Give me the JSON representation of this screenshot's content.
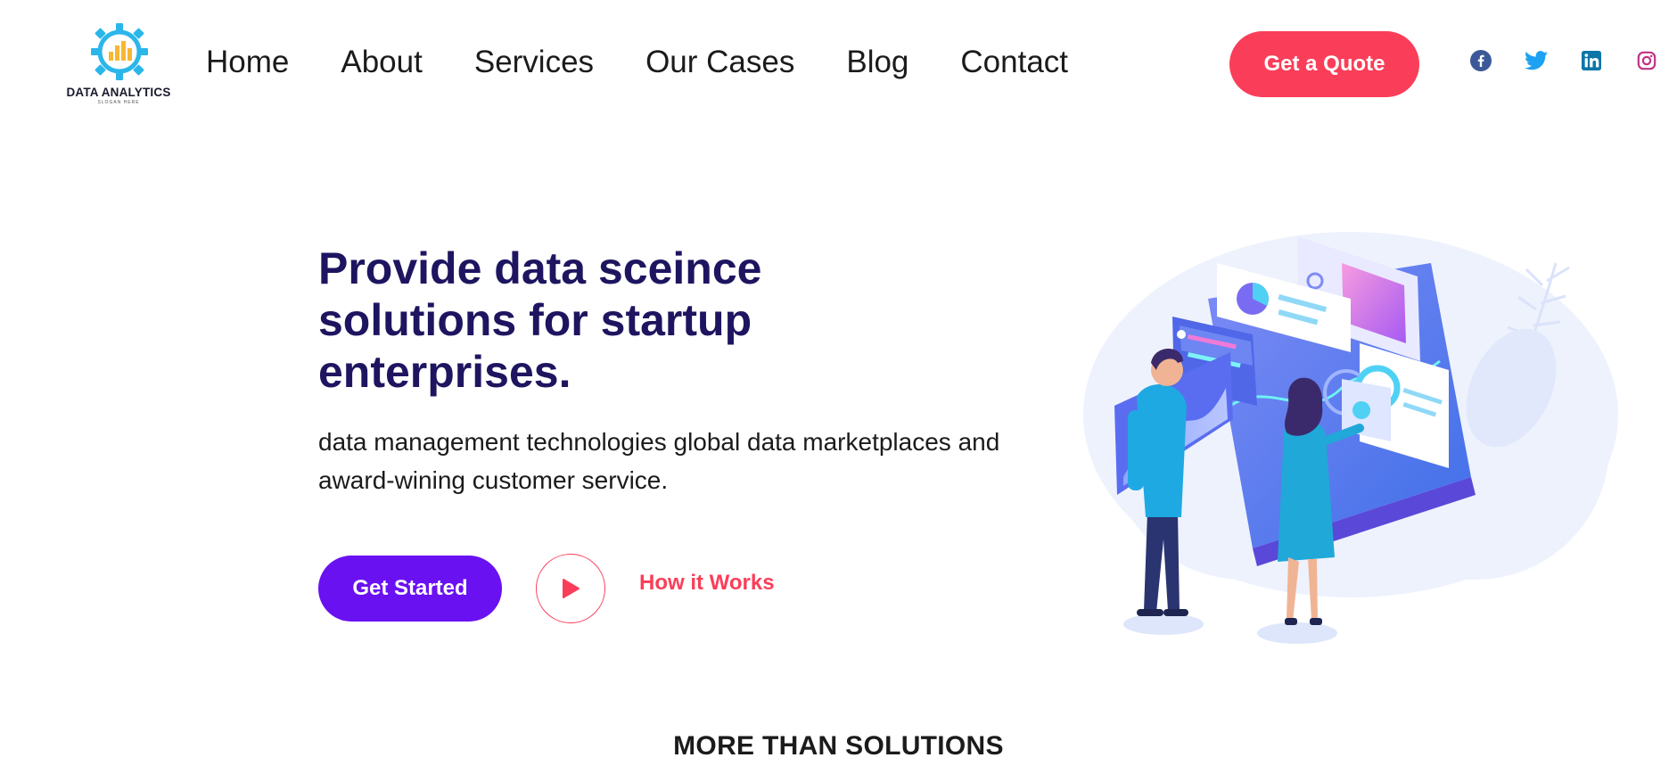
{
  "brand": {
    "name": "DATA ANALYTICS",
    "slogan": "SLOGAN HERE",
    "accent": "#fa3e59",
    "primary": "#6a11f2",
    "heading_color": "#1e1560"
  },
  "nav": {
    "items": [
      {
        "label": "Home"
      },
      {
        "label": "About"
      },
      {
        "label": "Services"
      },
      {
        "label": "Our Cases"
      },
      {
        "label": "Blog"
      },
      {
        "label": "Contact"
      }
    ],
    "cta_label": "Get a Quote"
  },
  "socials": [
    {
      "icon": "facebook-icon",
      "color": "#3b5998"
    },
    {
      "icon": "twitter-icon",
      "color": "#1da1f2"
    },
    {
      "icon": "linkedin-icon",
      "color": "#0e76a8"
    },
    {
      "icon": "instagram-icon",
      "color": "#c13584"
    }
  ],
  "hero": {
    "title": "Provide data sceince solutions for startup enterprises.",
    "description": "data management technologies global data marketplaces and award-wining customer service.",
    "primary_button": "Get Started",
    "secondary_link": "How it Works"
  },
  "section": {
    "title": "MORE THAN SOLUTIONS"
  }
}
